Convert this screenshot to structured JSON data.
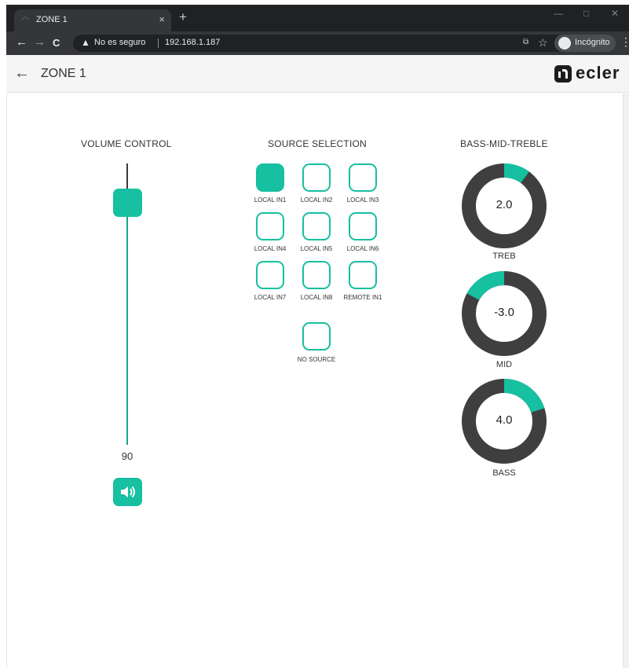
{
  "browser": {
    "tab_title": "ZONE 1",
    "tab_close": "×",
    "new_tab": "+",
    "win_min": "—",
    "win_max": "□",
    "win_close": "✕",
    "back": "←",
    "forward": "→",
    "reload": "C",
    "security_warning": "No es seguro",
    "url": "192.168.1.187",
    "incognito_label": "Incógnito",
    "menu": "⋮"
  },
  "header": {
    "back": "←",
    "title": "ZONE 1",
    "logo_text": "ecler"
  },
  "volume": {
    "title": "VOLUME CONTROL",
    "value": "90",
    "level": 0.9
  },
  "source": {
    "title": "SOURCE SELECTION",
    "items": [
      {
        "label": "LOCAL IN1",
        "selected": true
      },
      {
        "label": "LOCAL IN2",
        "selected": false
      },
      {
        "label": "LOCAL IN3",
        "selected": false
      },
      {
        "label": "LOCAL IN4",
        "selected": false
      },
      {
        "label": "LOCAL IN5",
        "selected": false
      },
      {
        "label": "LOCAL IN6",
        "selected": false
      },
      {
        "label": "LOCAL IN7",
        "selected": false
      },
      {
        "label": "LOCAL IN8",
        "selected": false
      },
      {
        "label": "REMOTE IN1",
        "selected": false
      },
      {
        "label": "NO SOURCE",
        "selected": false
      }
    ]
  },
  "eq": {
    "title": "BASS-MID-TREBLE",
    "knobs": [
      {
        "label": "TREB",
        "value": "2.0"
      },
      {
        "label": "MID",
        "value": "-3.0"
      },
      {
        "label": "BASS",
        "value": "4.0"
      }
    ]
  },
  "colors": {
    "accent": "#16c0a0",
    "knob_track": "#3f3f3f",
    "chrome_dark": "#202124"
  }
}
